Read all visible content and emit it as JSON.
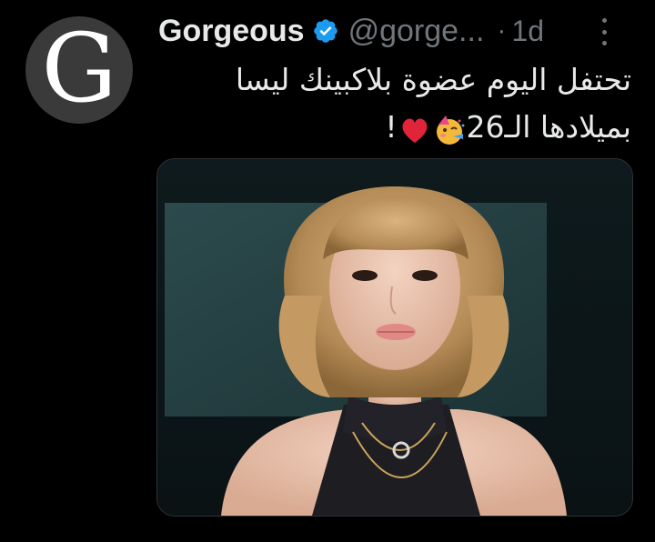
{
  "tweet": {
    "avatar_letter": "G",
    "display_name": "Gorgeous",
    "handle": "@gorge...",
    "separator": "·",
    "timestamp": "1d",
    "text_line1": "تحتفل اليوم عضوة بلاكبينك ليسا",
    "text_line2_prefix": "بميلادها الـ26",
    "text_line2_suffix": "!",
    "emojis": [
      "partying-face-emoji",
      "red-heart-emoji"
    ],
    "media": {
      "icon": "photo-of-woman-with-bangs"
    }
  },
  "colors": {
    "background": "#000000",
    "text_primary": "#e7e9ea",
    "text_secondary": "#71767b",
    "verified": "#1d9bf0",
    "avatar_bg": "#3a3a3a",
    "heart": "#e0243a"
  }
}
